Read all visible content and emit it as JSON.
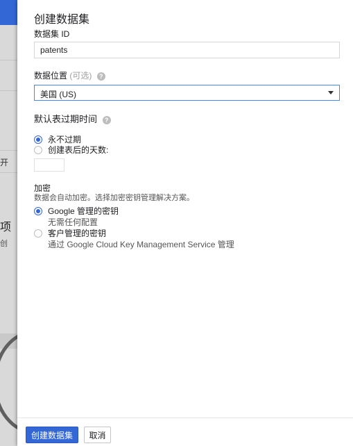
{
  "background": {
    "text_kai": "展开",
    "text_cixiang": "比项",
    "text_wenjian": "件创"
  },
  "panel": {
    "title": "创建数据集",
    "dataset_id": {
      "label": "数据集 ID",
      "value": "patents"
    },
    "location": {
      "label": "数据位置",
      "optional": "(可选)",
      "selected": "美国 (US)"
    },
    "expiration": {
      "label": "默认表过期时间",
      "options": [
        "永不过期",
        "创建表后的天数:"
      ],
      "selected_index": 0,
      "days_value": ""
    },
    "encryption": {
      "label": "加密",
      "description": "数据会自动加密。选择加密密钥管理解决方案。",
      "options": [
        {
          "label": "Google 管理的密钥",
          "sub": "无需任何配置"
        },
        {
          "label": "客户管理的密钥",
          "sub": "通过 Google Cloud Key Management Service 管理"
        }
      ],
      "selected_index": 0
    },
    "footer": {
      "create_label": "创建数据集",
      "cancel_label": "取消"
    }
  }
}
